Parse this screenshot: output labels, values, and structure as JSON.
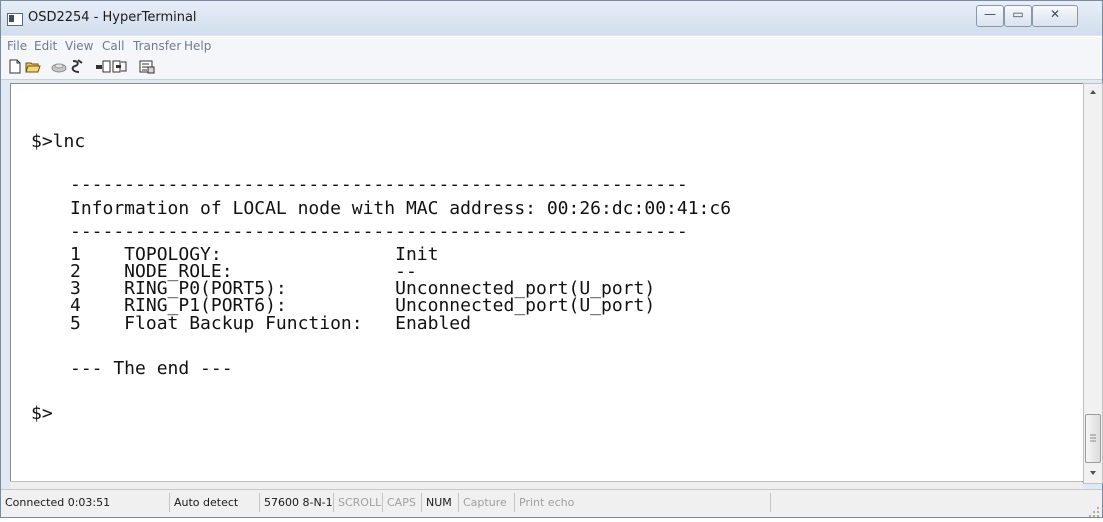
{
  "window": {
    "title": "OSD2254 - HyperTerminal",
    "controls": {
      "minimize_icon": "—",
      "maximize_icon": "▭",
      "close_icon": "✕"
    }
  },
  "menubar": [
    "File",
    "Edit",
    "View",
    "Call",
    "Transfer",
    "Help"
  ],
  "toolbar": [
    "new-document-icon",
    "open-folder-icon",
    "call-icon",
    "disconnect-icon",
    "send-icon",
    "receive-icon",
    "properties-icon"
  ],
  "terminal": {
    "lines": [
      "$>lnc",
      "---------------------------------------------------------",
      "Information of LOCAL node with MAC address: 00:26:dc:00:41:c6",
      "---------------------------------------------------------",
      "1    TOPOLOGY:                Init",
      "2    NODE_ROLE:               --",
      "3    RING_P0(PORT5):          Unconnected_port(U_port)",
      "4    RING_P1(PORT6):          Unconnected_port(U_port)",
      "5    Float Backup Function:   Enabled",
      "--- The end ---",
      "$>"
    ]
  },
  "statusbar": [
    {
      "label": "Connected 0:03:51",
      "active": true
    },
    {
      "label": "Auto detect",
      "active": true
    },
    {
      "label": "57600 8-N-1",
      "active": true
    },
    {
      "label": "SCROLL",
      "active": false
    },
    {
      "label": "CAPS",
      "active": false
    },
    {
      "label": "NUM",
      "active": true
    },
    {
      "label": "Capture",
      "active": false
    },
    {
      "label": "Print echo",
      "active": false
    }
  ],
  "colors": {
    "active_text": "#1a1a1a",
    "inactive_text": "#a0a0a0"
  }
}
